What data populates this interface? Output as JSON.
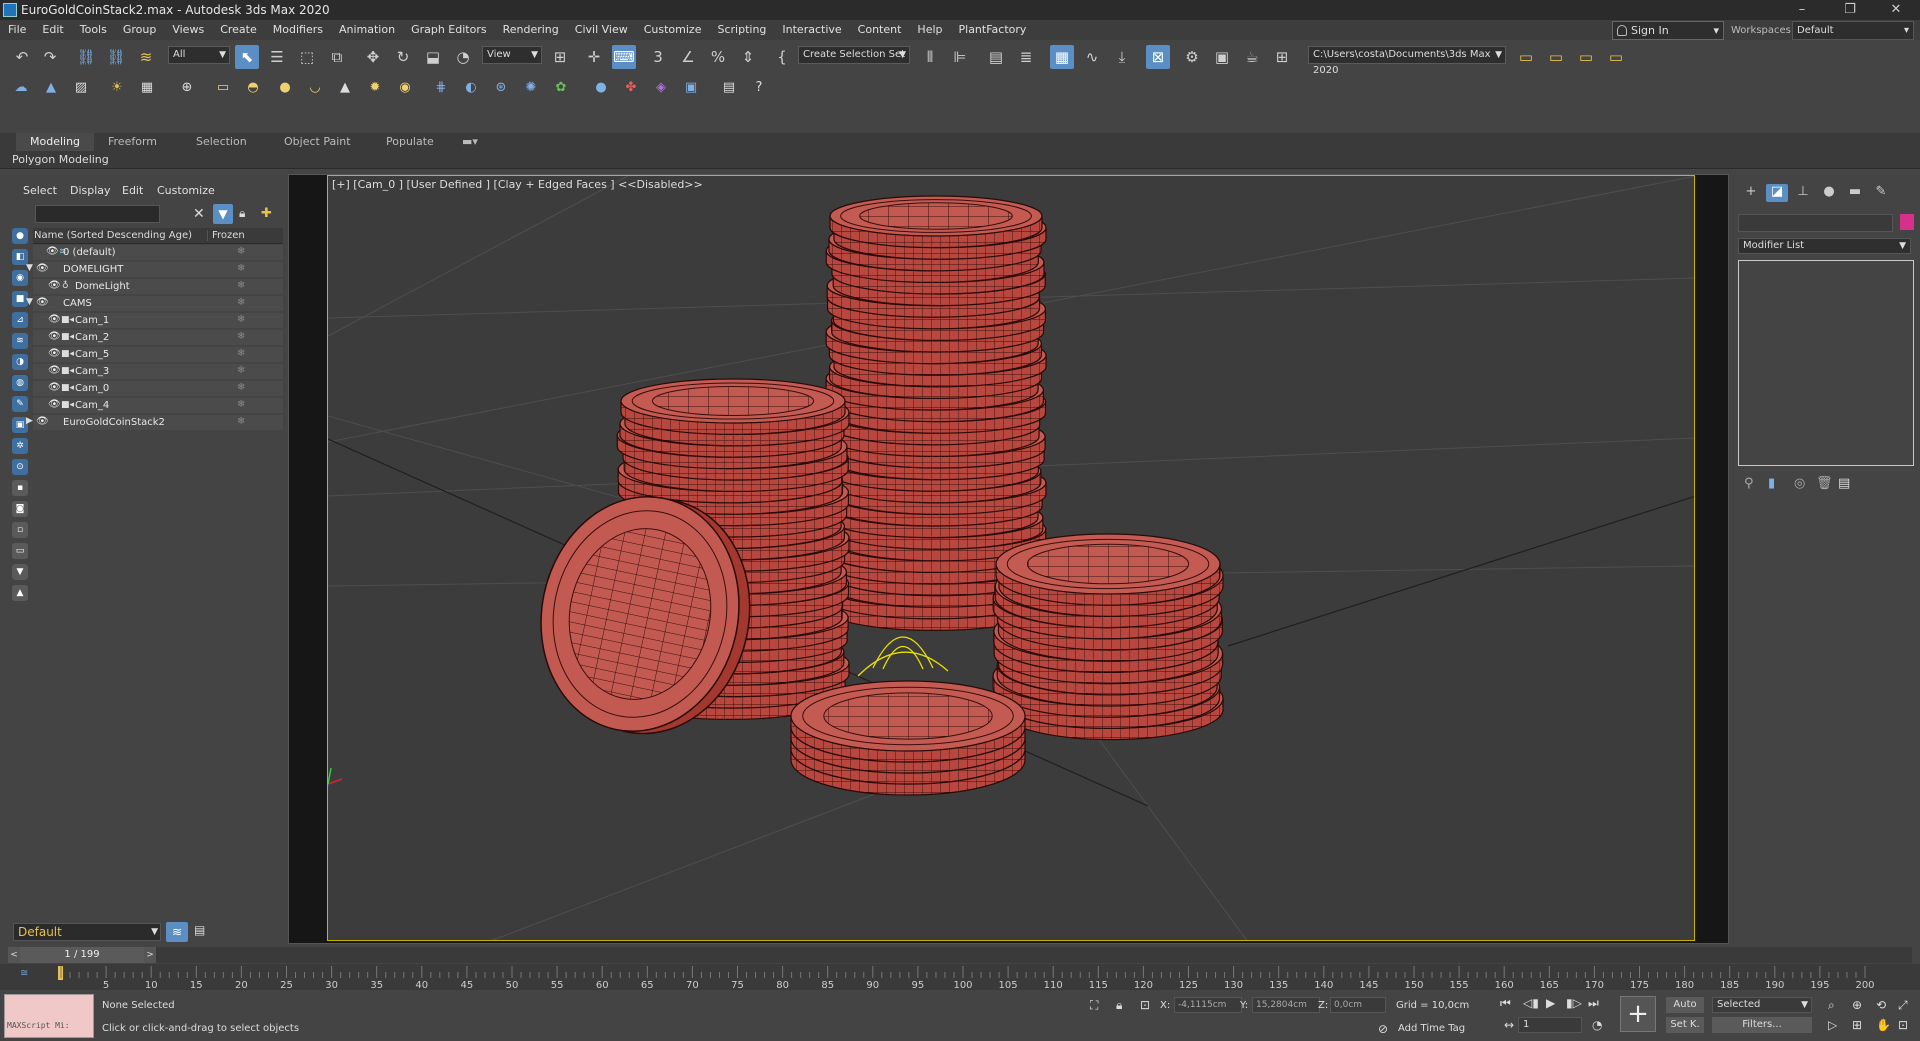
{
  "window": {
    "title": "EuroGoldCoinStack2.max - Autodesk 3ds Max 2020",
    "minimize": "–",
    "restore": "❐",
    "close": "✕"
  },
  "menu": [
    "File",
    "Edit",
    "Tools",
    "Group",
    "Views",
    "Create",
    "Modifiers",
    "Animation",
    "Graph Editors",
    "Rendering",
    "Civil View",
    "Customize",
    "Scripting",
    "Interactive",
    "Content",
    "Help",
    "PlantFactory"
  ],
  "account": {
    "signin": "Sign In",
    "workspaces_label": "Workspaces:",
    "workspace": "Default"
  },
  "toolbar": {
    "selection_filter": "All",
    "ref_coord": "View",
    "named_sel_set": "Create Selection Set",
    "project_path": "C:\\Users\\costa\\Documents\\3ds Max 2020",
    "angle_snap_label": "3"
  },
  "ribbon": {
    "tabs": [
      "Modeling",
      "Freeform",
      "Selection",
      "Object Paint",
      "Populate"
    ],
    "active": "Modeling",
    "sub": "Polygon Modeling"
  },
  "scene_explorer": {
    "tabs": [
      "Select",
      "Display",
      "Edit",
      "Customize"
    ],
    "col_name": "Name (Sorted Descending Age)",
    "col_frozen": "Frozen",
    "rows": [
      "0 (default)",
      "DOMELIGHT",
      "DomeLight",
      "CAMS",
      "Cam_1",
      "Cam_2",
      "Cam_5",
      "Cam_3",
      "Cam_0",
      "Cam_4",
      "EuroGoldCoinStack2"
    ]
  },
  "viewport": {
    "label": "[+] [Cam_0 ] [User Defined ] [Clay + Edged Faces ]  <<Disabled>>",
    "active_border": "#c8b400",
    "coin_color": "#c0504a"
  },
  "command_panel": {
    "modifier_list": "Modifier List",
    "object_color": "#d6308a"
  },
  "layer": {
    "current": "Default"
  },
  "time": {
    "slider": "1 / 199",
    "ticks": [
      "5",
      "10",
      "15",
      "20",
      "25",
      "30",
      "35",
      "40",
      "45",
      "50",
      "55",
      "60",
      "65",
      "70",
      "75",
      "80",
      "85",
      "90",
      "95",
      "100",
      "105",
      "110",
      "115",
      "120",
      "125",
      "130",
      "135",
      "140",
      "145",
      "150",
      "155",
      "160",
      "165",
      "170",
      "175",
      "180",
      "185",
      "190",
      "195",
      "200"
    ]
  },
  "status": {
    "maxscript": "MAXScript Mi:",
    "selection": "None Selected",
    "prompt": "Click or click-and-drag to select objects",
    "x_label": "X:",
    "x_val": "-4,1115cm",
    "y_label": "Y:",
    "y_val": "15,2804cm",
    "z_label": "Z:",
    "z_val": "0,0cm",
    "grid": "Grid = 10,0cm",
    "add_time_tag": "Add Time Tag",
    "auto": "Auto",
    "set_key": "Set K.",
    "key_filter": "Selected",
    "filters": "Filters...",
    "frame": "1"
  }
}
